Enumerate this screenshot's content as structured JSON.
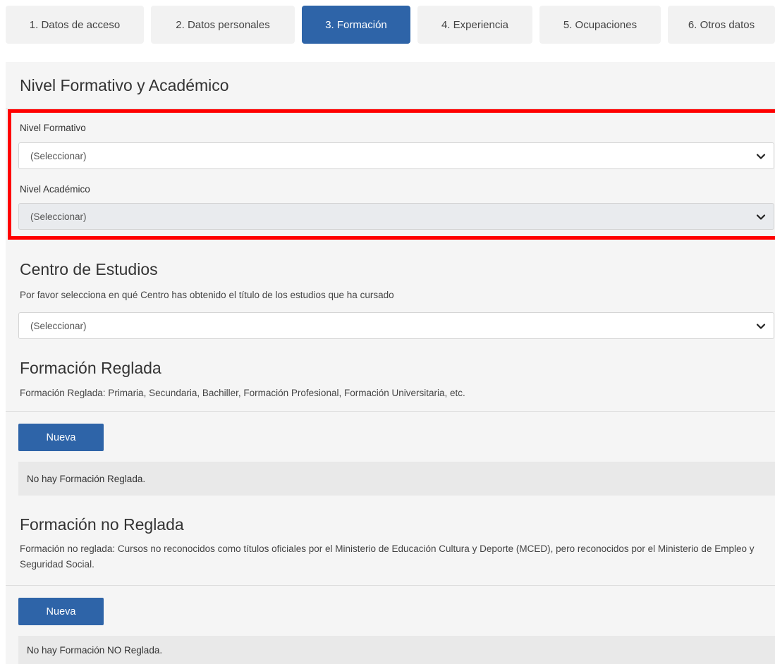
{
  "tabs": [
    {
      "label": "1. Datos de acceso"
    },
    {
      "label": "2. Datos personales"
    },
    {
      "label": "3. Formación"
    },
    {
      "label": "4. Experiencia"
    },
    {
      "label": "5. Ocupaciones"
    },
    {
      "label": "6. Otros datos"
    }
  ],
  "active_tab": "3. Formación",
  "nivel": {
    "title": "Nivel Formativo y Académico",
    "formativo_label": "Nivel Formativo",
    "formativo_value": "(Seleccionar)",
    "academico_label": "Nivel Académico",
    "academico_value": "(Seleccionar)"
  },
  "centro": {
    "title": "Centro de Estudios",
    "description": "Por favor selecciona en qué Centro has obtenido el título de los estudios que ha cursado",
    "value": "(Seleccionar)"
  },
  "reglada": {
    "title": "Formación Reglada",
    "description": "Formación Reglada: Primaria, Secundaria, Bachiller, Formación Profesional, Formación Universitaria, etc.",
    "button_label": "Nueva",
    "empty_text": "No hay Formación Reglada."
  },
  "no_reglada": {
    "title": "Formación no Reglada",
    "description": "Formación no reglada: Cursos no reconocidos como títulos oficiales por el Ministerio de Educación Cultura y Deporte (MCED), pero reconocidos por el Ministerio de Empleo y Seguridad Social.",
    "button_label": "Nueva",
    "empty_text": "No hay Formación NO Reglada."
  },
  "colors": {
    "accent": "#2e64a8",
    "highlight": "#ff0000",
    "panel": "#f5f5f5"
  },
  "icons": {
    "select_arrow": "chevron-down-icon"
  }
}
